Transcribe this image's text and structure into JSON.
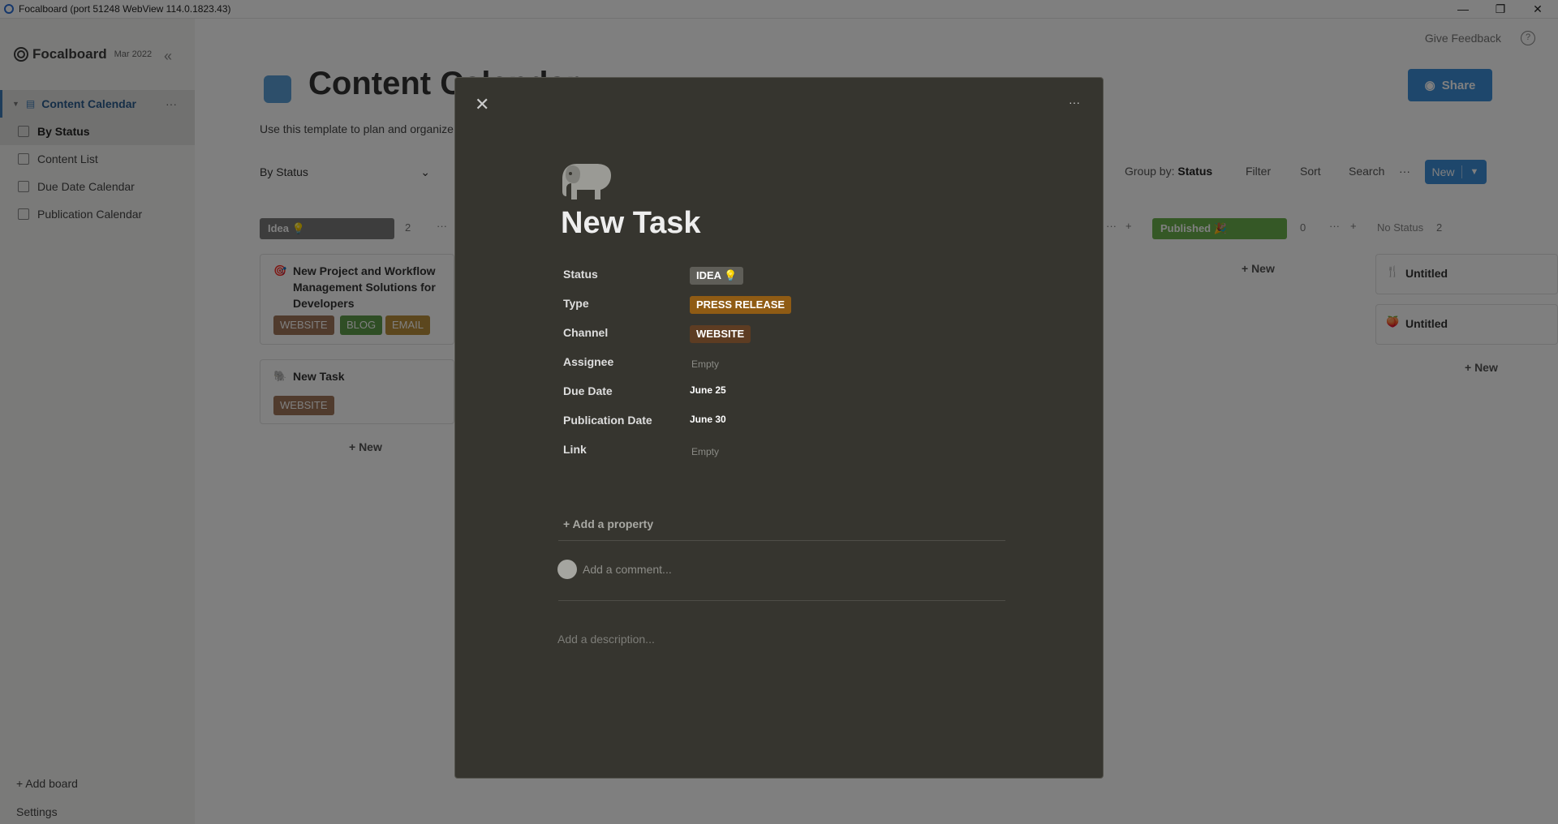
{
  "window": {
    "title": "Focalboard (port 51248 WebView 114.0.1823.43)"
  },
  "sidebar": {
    "logo": "Focalboard",
    "version": "Mar 2022",
    "board": "Content Calendar",
    "views": [
      "By Status",
      "Content List",
      "Due Date Calendar",
      "Publication Calendar"
    ],
    "add_board": "+ Add board",
    "settings": "Settings"
  },
  "header": {
    "give_feedback": "Give Feedback",
    "board_title": "Content Calendar",
    "share": "Share",
    "description": "Use this template to plan and organize your editorial content."
  },
  "viewbar": {
    "view_name": "By Status",
    "group_by_label": "Group by:",
    "group_by_value": "Status",
    "filter": "Filter",
    "sort": "Sort",
    "search": "Search",
    "new": "New"
  },
  "board": {
    "columns": [
      {
        "name": "Idea 💡",
        "count": "2",
        "color": "#7a7a7a"
      },
      {
        "name": "Published 🎉",
        "count": "0",
        "color": "#6ab04c"
      },
      {
        "name": "No Status",
        "count": "2"
      }
    ],
    "cards": [
      {
        "title": "New Project and Workflow Management Solutions for Developers",
        "tags": [
          "WEBSITE",
          "BLOG",
          "EMAIL"
        ]
      },
      {
        "title": "New Task",
        "tags": [
          "WEBSITE"
        ]
      },
      {
        "title": "Untitled"
      },
      {
        "title": "Untitled"
      }
    ],
    "add_new": "+ New"
  },
  "dialog": {
    "title": "New Task",
    "properties": [
      {
        "name": "Status",
        "value": "IDEA 💡",
        "kind": "pill",
        "color": "#5f5e58"
      },
      {
        "name": "Type",
        "value": "PRESS RELEASE",
        "kind": "pill",
        "color": "#8f5b14"
      },
      {
        "name": "Channel",
        "value": "WEBSITE",
        "kind": "pill",
        "color": "#5d3c22"
      },
      {
        "name": "Assignee",
        "value": "Empty",
        "kind": "empty"
      },
      {
        "name": "Due Date",
        "value": "June 25",
        "kind": "date"
      },
      {
        "name": "Publication Date",
        "value": "June 30",
        "kind": "date"
      },
      {
        "name": "Link",
        "value": "Empty",
        "kind": "empty"
      }
    ],
    "add_property": "+ Add a property",
    "comment_placeholder": "Add a comment...",
    "description_placeholder": "Add a description..."
  }
}
